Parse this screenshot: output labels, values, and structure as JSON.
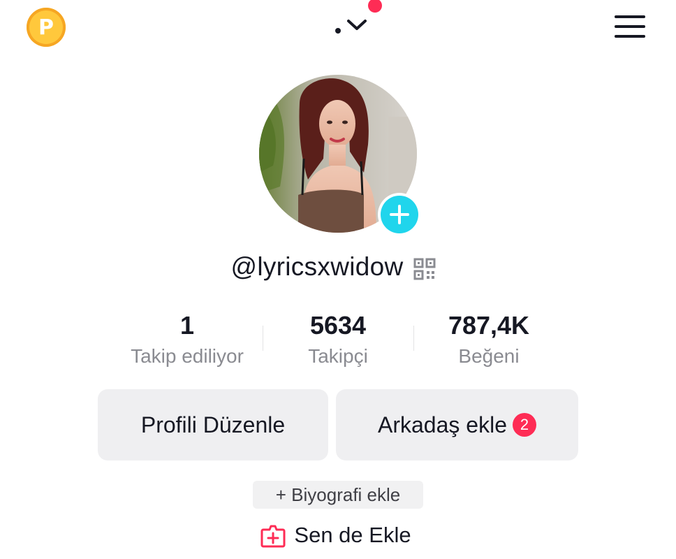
{
  "top_bar": {
    "coin_letter": "P",
    "accent": "#fe2c55",
    "coin_color": "#ffc83c"
  },
  "profile": {
    "username": "@lyricsxwidow",
    "avatar_add_icon": "plus-icon"
  },
  "stats": [
    {
      "value": "1",
      "label": "Takip ediliyor"
    },
    {
      "value": "5634",
      "label": "Takipçi"
    },
    {
      "value": "787,4K",
      "label": "Beğeni"
    }
  ],
  "actions": {
    "edit_profile": "Profili Düzenle",
    "add_friends": "Arkadaş ekle",
    "add_friends_badge": "2"
  },
  "bio": {
    "add_bio": "+ Biyografi ekle"
  },
  "add_yours": {
    "label": "Sen de Ekle",
    "icon": "add-yours-icon",
    "icon_color": "#fe2c55"
  },
  "colors": {
    "text_primary": "#161823",
    "text_secondary": "#8a8b91",
    "button_bg": "#efeff1",
    "accent_cyan": "#20d5ec"
  }
}
